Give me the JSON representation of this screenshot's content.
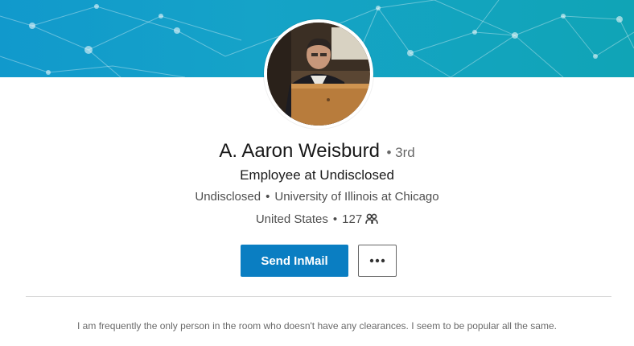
{
  "profile": {
    "name": "A. Aaron Weisburd",
    "degree": "• 3rd",
    "headline": "Employee at Undisclosed",
    "company": "Undisclosed",
    "school": "University of Illinois at Chicago",
    "location": "United States",
    "connections": "127",
    "summary": "I am frequently the only person in the room who doesn't have any clearances. I seem to be popular all the same."
  },
  "actions": {
    "primary_label": "Send InMail"
  },
  "icons": {
    "connections": "connections-icon",
    "more": "more-options-icon"
  },
  "colors": {
    "accent": "#0a7ec2",
    "banner_start": "#1199cc",
    "banner_end": "#10a4b6"
  }
}
